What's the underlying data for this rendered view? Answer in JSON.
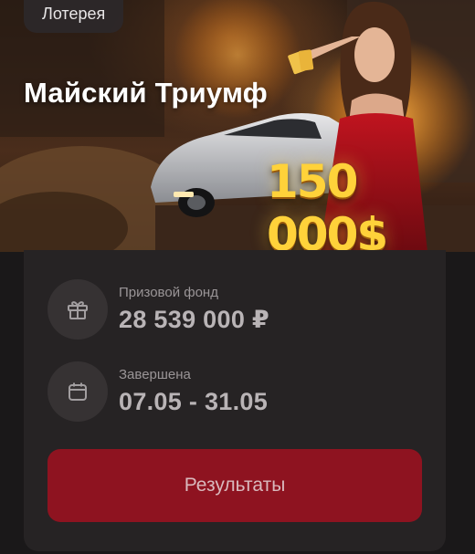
{
  "banner": {
    "tag_label": "Лотерея",
    "title": "Майский Триумф",
    "prize_amount": "150 000$"
  },
  "details": {
    "prize_fund": {
      "label": "Призовой фонд",
      "value": "28 539 000 ₽",
      "icon": "gift-icon"
    },
    "period": {
      "label": "Завершена",
      "value": "07.05 - 31.05",
      "icon": "calendar-icon"
    }
  },
  "actions": {
    "results_label": "Результаты"
  },
  "colors": {
    "background": "#1a1819",
    "card": "#262324",
    "icon_circle": "#363233",
    "button": "#8e1320",
    "prize_gold": "#ffd23a"
  }
}
